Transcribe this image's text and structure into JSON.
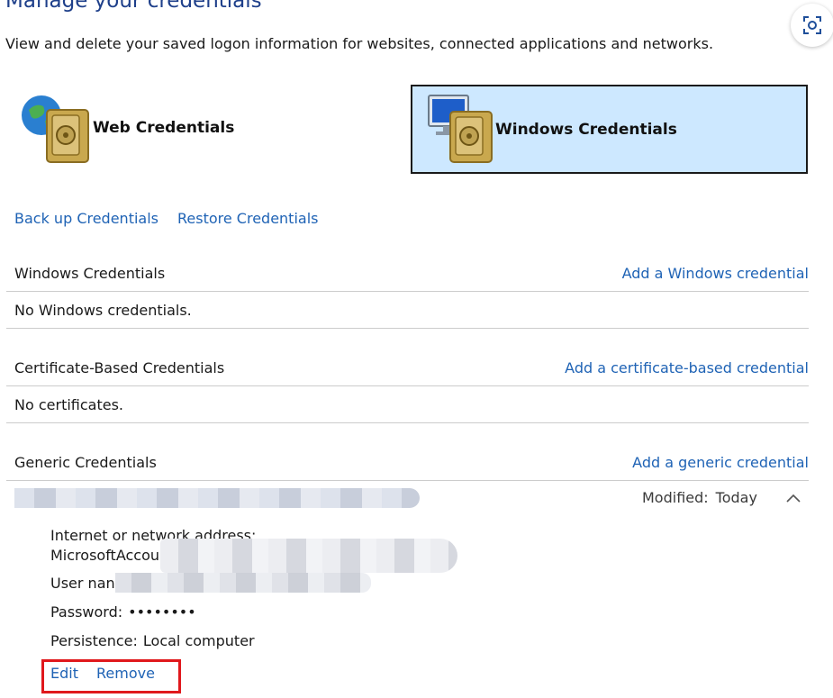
{
  "header": {
    "title": "Manage your credentials",
    "subtitle": "View and delete your saved logon information for websites, connected applications and networks."
  },
  "credential_types": {
    "web": {
      "label": "Web Credentials",
      "icon": "globe-vault-icon"
    },
    "windows": {
      "label": "Windows Credentials",
      "icon": "monitor-vault-icon",
      "selected": true
    }
  },
  "links": {
    "backup": "Back up Credentials",
    "restore": "Restore Credentials"
  },
  "sections": {
    "windows": {
      "title": "Windows Credentials",
      "action": "Add a Windows credential",
      "empty": "No Windows credentials."
    },
    "certificate": {
      "title": "Certificate-Based Credentials",
      "action": "Add a certificate-based credential",
      "empty": "No certificates."
    },
    "generic": {
      "title": "Generic Credentials",
      "action": "Add a generic credential"
    }
  },
  "generic_entry": {
    "modified_label": "Modified:",
    "modified_value": "Today",
    "address_label": "Internet or network address:",
    "address_value": "MicrosoftAccou",
    "username_label": "User nan",
    "password_label": "Password:",
    "password_value": "••••••••",
    "persistence_label": "Persistence:",
    "persistence_value": "Local computer",
    "edit_label": "Edit",
    "remove_label": "Remove"
  },
  "colors": {
    "link": "#1f63b5",
    "title": "#1e3f8a",
    "selected_bg": "#cde8ff",
    "highlight_box": "#e0181c"
  }
}
